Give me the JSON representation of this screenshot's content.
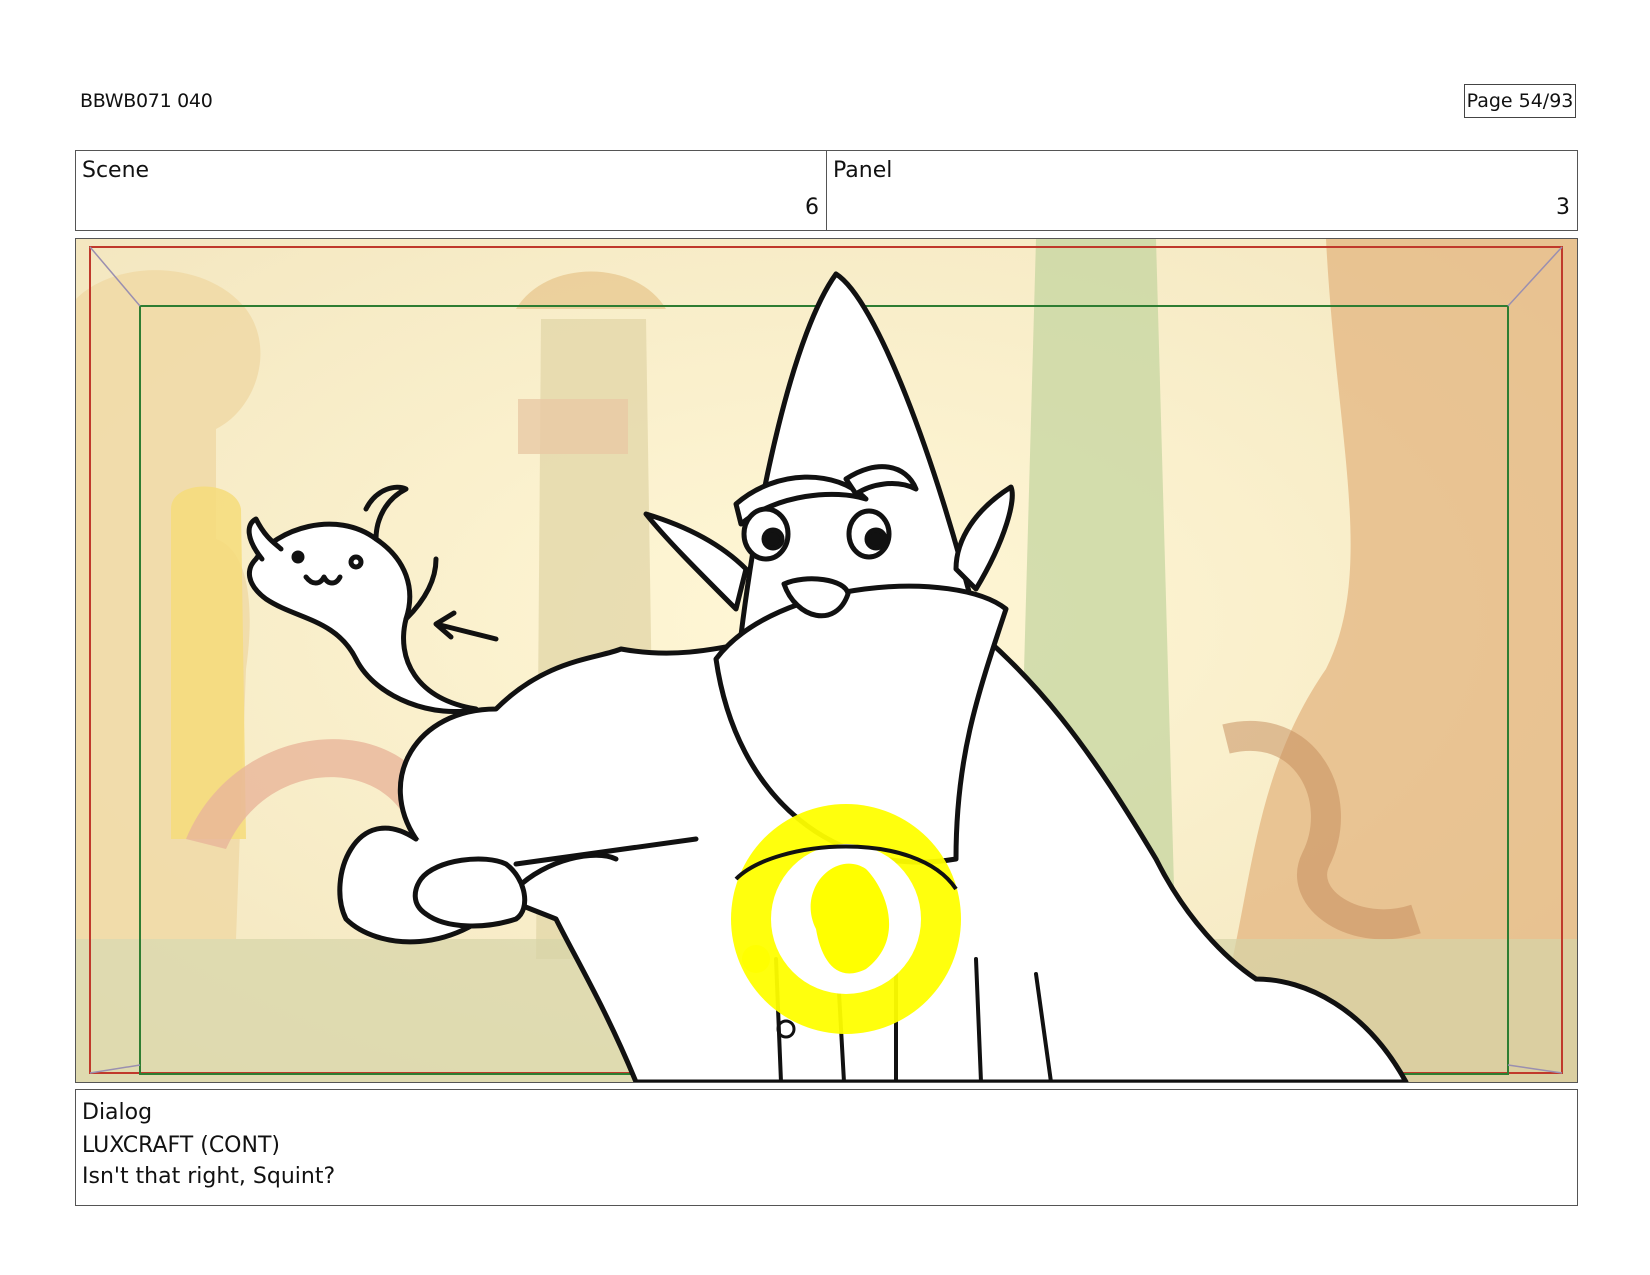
{
  "header": {
    "doc_id": "BBWB071 040",
    "page": "Page 54/93"
  },
  "info": {
    "scene_label": "Scene",
    "scene_value": "6",
    "panel_label": "Panel",
    "panel_value": "3"
  },
  "dialog": {
    "label": "Dialog",
    "speaker": "LUXCRAFT (CONT)",
    "line": "Isn't that right, Squint?"
  },
  "colors": {
    "safe_area_outer": "#c0392b",
    "safe_area_inner": "#2e7d32",
    "glow": "#ffff00"
  }
}
